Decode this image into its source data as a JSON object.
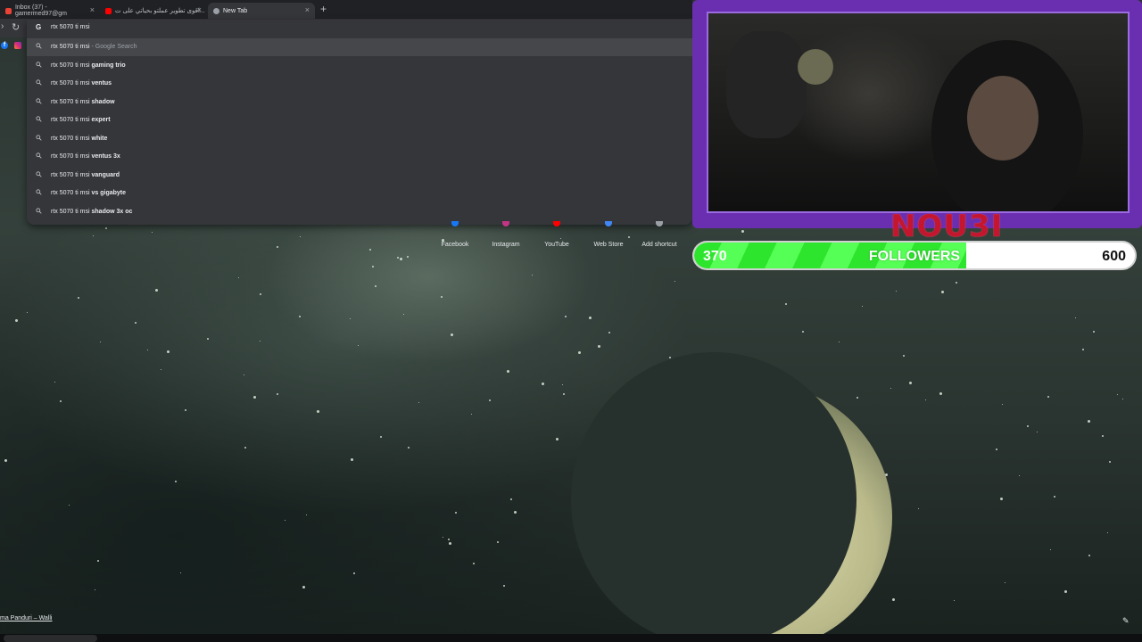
{
  "browser": {
    "tabs": [
      {
        "label": "Inbox (37) - gamermed97@gm",
        "active": false,
        "favicon_color": "#ea4335"
      },
      {
        "label": "اقوى تطوير عملتو بحياتي على ت...",
        "active": false,
        "favicon_color": "#ff0000"
      },
      {
        "label": "New Tab",
        "active": true,
        "favicon_color": "#9aa0a6"
      }
    ],
    "omnibox": {
      "query": "rtx 5070 ti msi",
      "suggestions": [
        {
          "prefix": "rtx 5070 ti msi",
          "bold": "",
          "extra": " - Google Search"
        },
        {
          "prefix": "rtx 5070 ti msi ",
          "bold": "gaming trio",
          "extra": ""
        },
        {
          "prefix": "rtx 5070 ti msi ",
          "bold": "ventus",
          "extra": ""
        },
        {
          "prefix": "rtx 5070 ti msi ",
          "bold": "shadow",
          "extra": ""
        },
        {
          "prefix": "rtx 5070 ti msi ",
          "bold": "expert",
          "extra": ""
        },
        {
          "prefix": "rtx 5070 ti msi ",
          "bold": "white",
          "extra": ""
        },
        {
          "prefix": "rtx 5070 ti msi ",
          "bold": "ventus 3x",
          "extra": ""
        },
        {
          "prefix": "rtx 5070 ti msi ",
          "bold": "vanguard",
          "extra": ""
        },
        {
          "prefix": "rtx 5070 ti msi ",
          "bold": "vs gigabyte",
          "extra": ""
        },
        {
          "prefix": "rtx 5070 ti msi ",
          "bold": "shadow 3x oc",
          "extra": ""
        }
      ]
    },
    "shortcuts": [
      {
        "label": "Facebook",
        "color": "#1877f2"
      },
      {
        "label": "Instagram",
        "color": "#c13584"
      },
      {
        "label": "YouTube",
        "color": "#ff0000"
      },
      {
        "label": "Web Store",
        "color": "#4285f4"
      },
      {
        "label": "Add shortcut",
        "color": "#9aa0a6"
      }
    ],
    "wallpaper_credit": "ma Panduri – Walli"
  },
  "overlay": {
    "streamer_name": "NOU3I",
    "frame_color": "#6a2fb0",
    "goal": {
      "current": "370",
      "label": "FOLLOWERS",
      "target": "600",
      "progress": 0.617,
      "fill_color": "#2ee52e"
    }
  }
}
